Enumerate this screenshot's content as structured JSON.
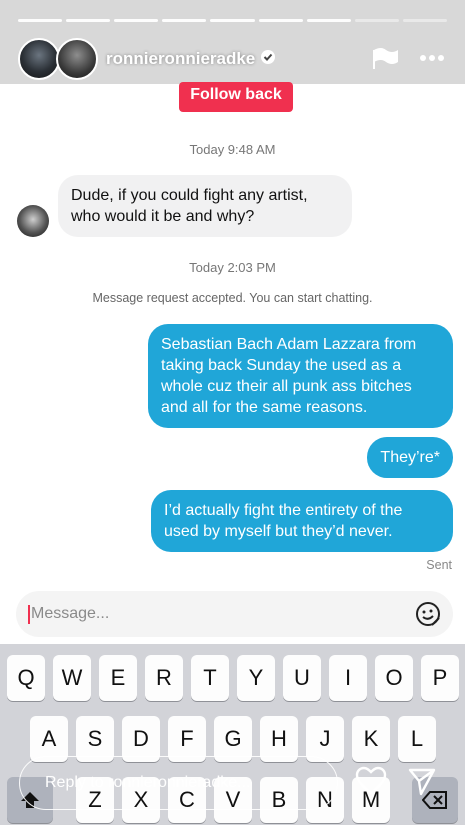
{
  "story": {
    "username": "ronnieronnieradke",
    "progress_segments": 9,
    "progress_filled": 7,
    "reply_placeholder": "Reply to ronnieronnieradke..."
  },
  "dm": {
    "follow_back_label": "Follow back",
    "timestamp_1": "Today 9:48 AM",
    "incoming_message": "Dude, if you could fight any artist, who would it be and why?",
    "timestamp_2": "Today 2:03 PM",
    "request_note": "Message request accepted. You can start chatting.",
    "outgoing": [
      "Sebastian Bach Adam Lazzara from taking back Sunday the used as a whole cuz their all punk ass bitches and all for the same reasons.",
      "They’re*",
      "I’d actually fight the entirety of the used by myself but they’d never."
    ],
    "sent_label": "Sent",
    "composer_placeholder": "Message..."
  },
  "keyboard": {
    "row1": [
      "Q",
      "W",
      "E",
      "R",
      "T",
      "Y",
      "U",
      "I",
      "O",
      "P"
    ],
    "row2": [
      "A",
      "S",
      "D",
      "F",
      "G",
      "H",
      "J",
      "K",
      "L"
    ],
    "row3": [
      "Z",
      "X",
      "C",
      "V",
      "B",
      "N",
      "M"
    ]
  },
  "colors": {
    "accent_blue": "#20a6d8",
    "follow_red": "#f0304f"
  },
  "icons": [
    "verified-icon",
    "flag-icon",
    "more-icon",
    "emoji-icon",
    "shift-icon",
    "backspace-icon",
    "heart-icon",
    "send-icon"
  ]
}
